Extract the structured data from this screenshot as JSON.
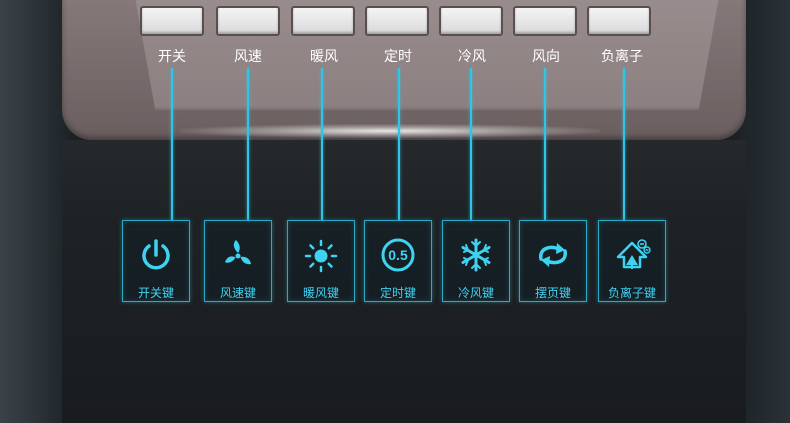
{
  "accent_color": "#2ec5e6",
  "panel_buttons": [
    {
      "label": "开关"
    },
    {
      "label": "风速"
    },
    {
      "label": "暖风"
    },
    {
      "label": "定时"
    },
    {
      "label": "冷风"
    },
    {
      "label": "风向"
    },
    {
      "label": "负离子"
    }
  ],
  "keys": [
    {
      "label": "开关键",
      "icon": "power-icon"
    },
    {
      "label": "风速键",
      "icon": "fan-icon"
    },
    {
      "label": "暖风键",
      "icon": "sun-icon"
    },
    {
      "label": "定时键",
      "icon": "timer-icon",
      "icon_text": "0.5"
    },
    {
      "label": "冷风键",
      "icon": "snowflake-icon"
    },
    {
      "label": "摆页键",
      "icon": "swing-arrows-icon"
    },
    {
      "label": "负离子键",
      "icon": "negative-ion-icon"
    }
  ]
}
